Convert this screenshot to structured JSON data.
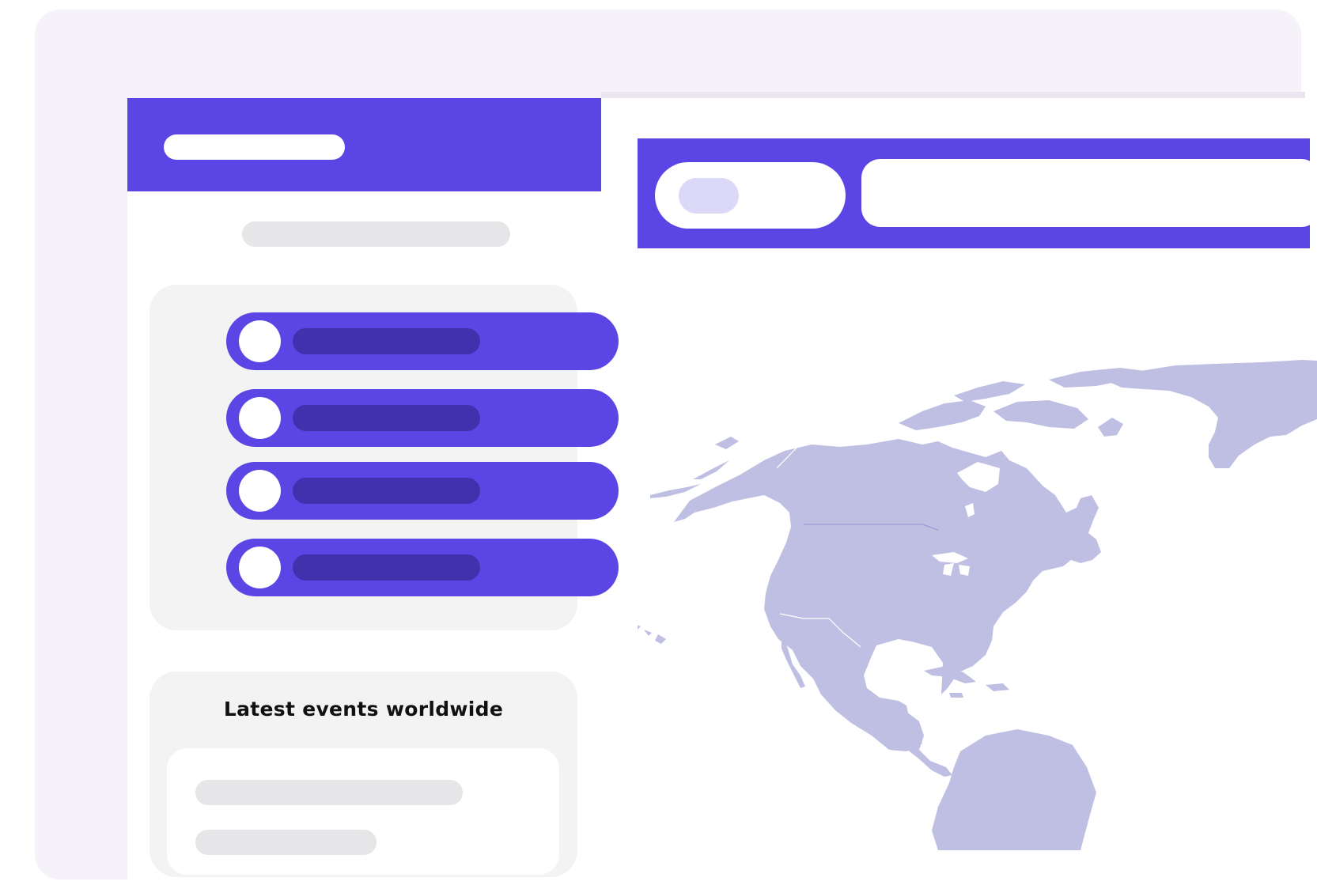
{
  "events": {
    "title": "Latest events worldwide"
  },
  "search": {
    "placeholder": ""
  },
  "list": {
    "item_count_visible": 4
  },
  "colors": {
    "accent": "#5c45e5",
    "accent_dark": "#4230ac",
    "frame_bg": "#f6f2f9",
    "panel_bg": "#f3f3f3",
    "placeholder": "#e6e6e8",
    "chip": "#dcd8f8",
    "map_land": "#bfbfe3"
  },
  "icons": {
    "map": "world-map-icon",
    "avatar": "avatar-circle-icon"
  }
}
